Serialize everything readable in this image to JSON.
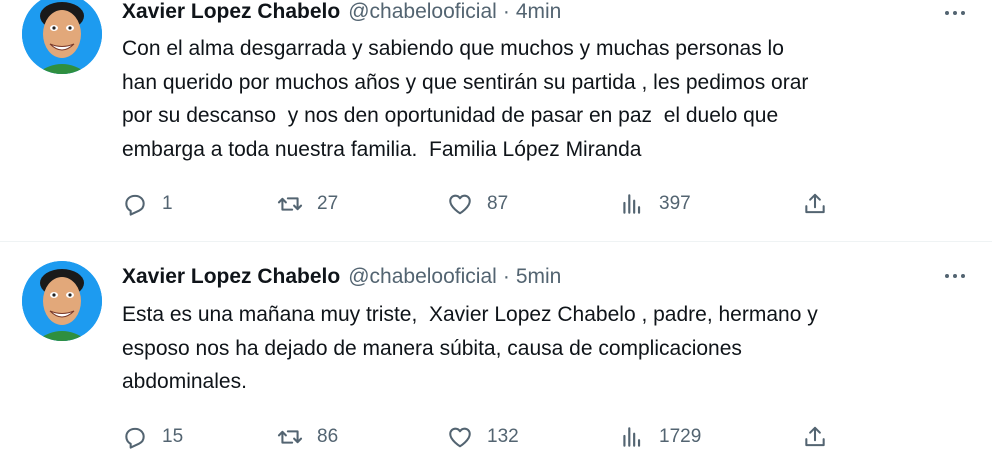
{
  "tweets": [
    {
      "author_name": "Xavier Lopez Chabelo",
      "handle": "@chabelooficial",
      "separator": "·",
      "time": "4min",
      "text": "Con el alma desgarrada y sabiendo que muchos y muchas personas lo\nhan querido por muchos años y que sentirán su partida , les pedimos orar\npor su descanso  y nos den oportunidad de pasar en paz  el duelo que\nembarga a toda nuestra familia.  Familia López Miranda",
      "replies": "1",
      "retweets": "27",
      "likes": "87",
      "views": "397",
      "icons": {
        "reply": "reply-icon",
        "retweet": "retweet-icon",
        "like": "heart-icon",
        "views": "views-icon",
        "share": "share-icon",
        "more": "more-icon"
      }
    },
    {
      "author_name": "Xavier Lopez Chabelo",
      "handle": "@chabelooficial",
      "separator": "·",
      "time": "5min",
      "text": "Esta es una mañana muy triste,  Xavier Lopez Chabelo , padre, hermano y\nesposo nos ha dejado de manera súbita, causa de complicaciones\nabdominales.",
      "replies": "15",
      "retweets": "86",
      "likes": "132",
      "views": "1729",
      "icons": {
        "reply": "reply-icon",
        "retweet": "retweet-icon",
        "like": "heart-icon",
        "views": "views-icon",
        "share": "share-icon",
        "more": "more-icon"
      }
    }
  ],
  "colors": {
    "text_primary": "#0f1419",
    "text_secondary": "#536471",
    "avatar_background": "#1d9bf0",
    "divider": "#eff3f4"
  }
}
